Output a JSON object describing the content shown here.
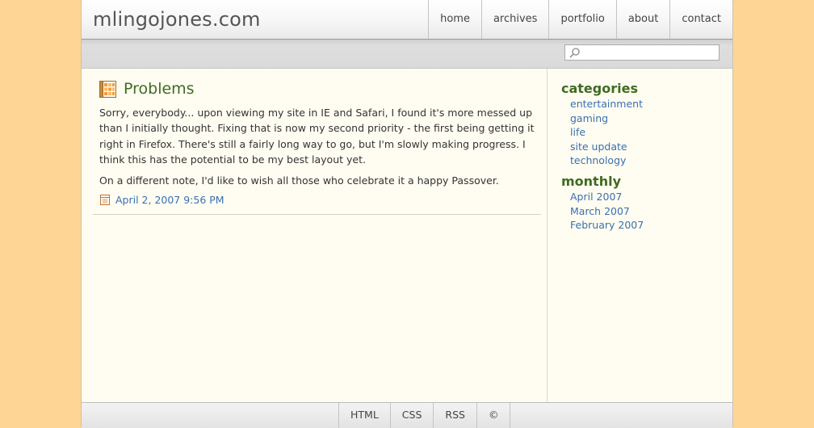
{
  "site": {
    "title": "mlingojones.com"
  },
  "nav": {
    "items": [
      {
        "label": "home"
      },
      {
        "label": "archives"
      },
      {
        "label": "portfolio"
      },
      {
        "label": "about"
      },
      {
        "label": "contact"
      }
    ]
  },
  "search": {
    "placeholder": "",
    "value": ""
  },
  "post": {
    "title": "Problems",
    "paragraphs": [
      "Sorry, everybody... upon viewing my site in IE and Safari, I found it's more messed up than I initially thought. Fixing that is now my second priority - the first being getting it right in Firefox. There's still a fairly long way to go, but I'm slowly making progress. I think this has the potential to be my best layout yet.",
      "On a different note, I'd like to wish all those who celebrate it a happy Passover."
    ],
    "date": "April 2, 2007 9:56 PM"
  },
  "sidebar": {
    "categories_heading": "categories",
    "categories": [
      "entertainment",
      "gaming",
      "life",
      "site update",
      "technology"
    ],
    "monthly_heading": "monthly",
    "monthly": [
      "April 2007",
      "March 2007",
      "February 2007"
    ]
  },
  "footer": {
    "items": [
      {
        "label": "HTML"
      },
      {
        "label": "CSS"
      },
      {
        "label": "RSS"
      },
      {
        "label": "©"
      }
    ]
  },
  "colors": {
    "background": "#ffd596",
    "page": "#fffdf1",
    "heading_green": "#3f6b22",
    "link_blue": "#3a6fb0"
  },
  "icons": {
    "post": "document-grid-icon",
    "date": "calendar-icon",
    "search": "magnifier-icon"
  }
}
